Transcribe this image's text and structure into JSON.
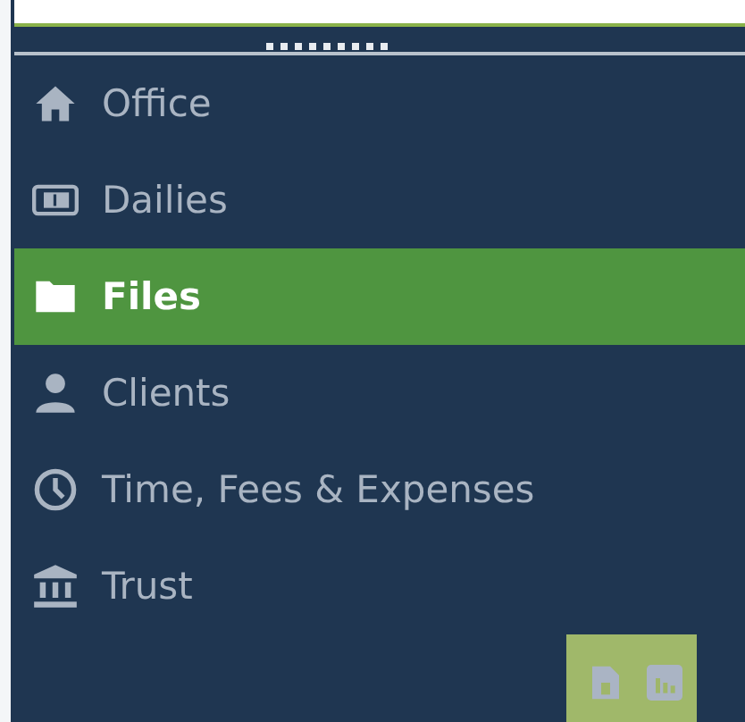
{
  "menu": [
    {
      "label": "Office",
      "selected": false
    },
    {
      "label": "Dailies",
      "selected": false
    },
    {
      "label": "Files",
      "selected": true
    },
    {
      "label": "Clients",
      "selected": false
    },
    {
      "label": "Time, Fees & Expenses",
      "selected": false
    },
    {
      "label": "Trust",
      "selected": false
    }
  ]
}
